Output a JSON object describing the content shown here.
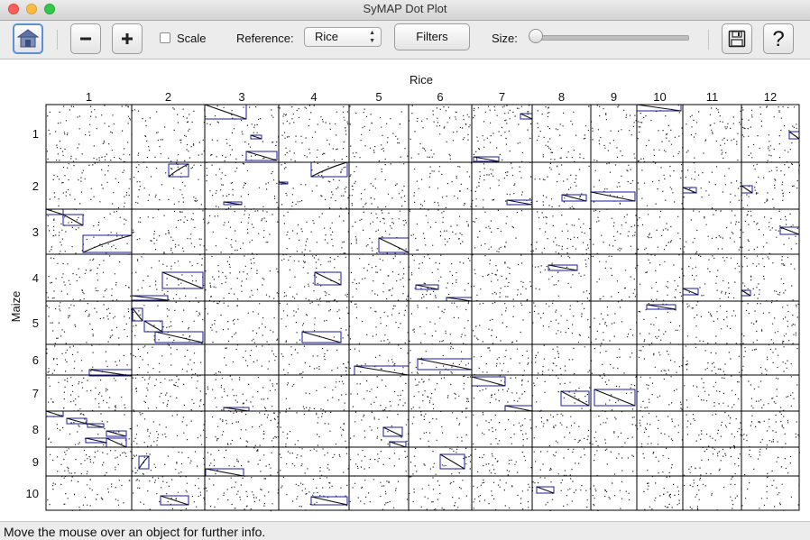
{
  "window": {
    "title": "SyMAP Dot Plot"
  },
  "toolbar": {
    "home_icon": "home-icon",
    "zoom_out_icon": "minus-icon",
    "zoom_in_icon": "plus-icon",
    "scale_label": "Scale",
    "scale_checked": false,
    "reference_label": "Reference:",
    "reference_value": "Rice",
    "filters_label": "Filters",
    "size_label": "Size:",
    "size_level": 0.0,
    "save_icon": "floppy-disk-icon",
    "help_icon": "question-mark-icon"
  },
  "plot": {
    "x_title": "Rice",
    "y_title": "Maize",
    "grid_color": "#000000",
    "box_color": "#1a1aa6",
    "x_chromosomes": [
      "1",
      "2",
      "3",
      "4",
      "5",
      "6",
      "7",
      "8",
      "9",
      "10",
      "11",
      "12"
    ],
    "y_chromosomes": [
      "1",
      "2",
      "3",
      "4",
      "5",
      "6",
      "7",
      "8",
      "9",
      "10"
    ]
  },
  "status": {
    "text": "Move the mouse over an object for further info."
  }
}
